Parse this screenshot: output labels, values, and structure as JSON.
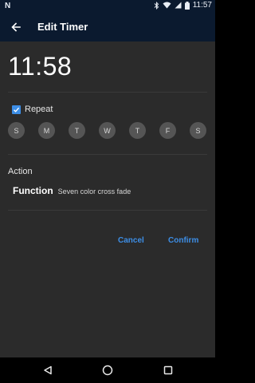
{
  "status_bar": {
    "left_icon": "n-notification-icon",
    "time": "11:57",
    "icons": [
      "bluetooth-icon",
      "wifi-icon",
      "signal-icon",
      "battery-icon"
    ]
  },
  "app_bar": {
    "title": "Edit Timer",
    "back_icon": "arrow-left-icon"
  },
  "timer": {
    "time": "11:58"
  },
  "repeat": {
    "label": "Repeat",
    "checked": true,
    "days": [
      "S",
      "M",
      "T",
      "W",
      "T",
      "F",
      "S"
    ]
  },
  "action": {
    "label": "Action",
    "function_label": "Function",
    "function_value": "Seven color cross fade"
  },
  "buttons": {
    "cancel": "Cancel",
    "confirm": "Confirm"
  },
  "colors": {
    "accent": "#3d8ee6",
    "app_bar": "#0b1a2f",
    "background": "#2b2b2b",
    "day_circle": "#555555"
  },
  "nav_bar": {
    "icons": [
      "back-triangle-icon",
      "home-circle-icon",
      "recents-square-icon"
    ]
  }
}
